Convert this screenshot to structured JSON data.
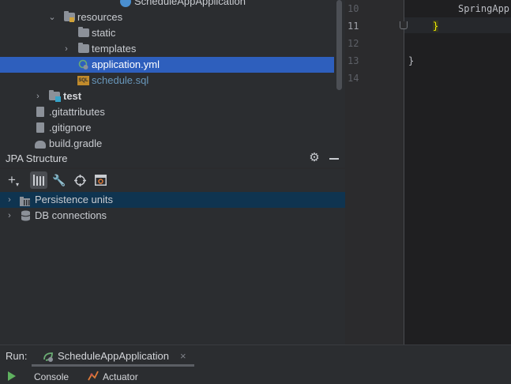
{
  "project_tree": {
    "items": [
      {
        "label": "ScheduleAppApplication"
      },
      {
        "label": "resources"
      },
      {
        "label": "static"
      },
      {
        "label": "templates"
      },
      {
        "label": "application.yml"
      },
      {
        "label": "schedule.sql"
      },
      {
        "label": "test"
      },
      {
        "label": ".gitattributes"
      },
      {
        "label": ".gitignore"
      },
      {
        "label": "build.gradle"
      }
    ]
  },
  "jpa": {
    "title": "JPA Structure",
    "items": [
      {
        "label": "Persistence units"
      },
      {
        "label": "DB connections"
      }
    ]
  },
  "editor": {
    "line_numbers": [
      "10",
      "11",
      "12",
      "13",
      "14"
    ],
    "lines": [
      "SpringApp",
      "}",
      "",
      "}",
      ""
    ]
  },
  "run": {
    "label": "Run:",
    "config": "ScheduleAppApplication"
  },
  "bottom": {
    "console": "Console",
    "actuator": "Actuator"
  },
  "colors": {
    "selection": "#2e5fbd",
    "sql_file": "#6897bb",
    "brace_highlight": "#f2f200"
  }
}
